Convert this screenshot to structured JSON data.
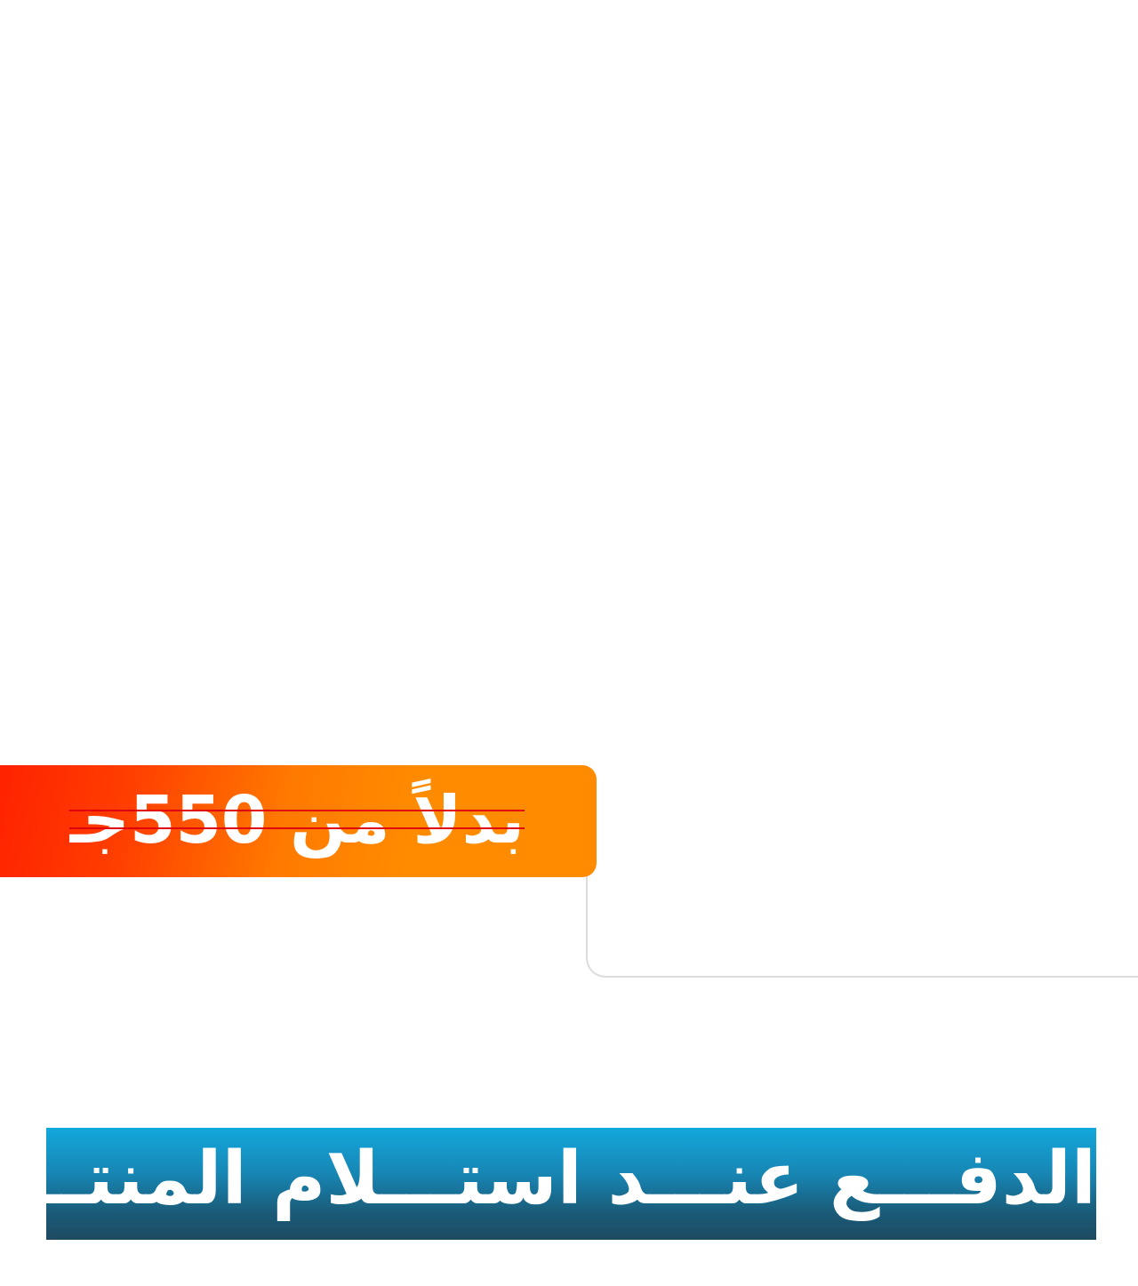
{
  "price_banner": {
    "text": "بدلاً من 550جـ",
    "strike_color": "#e0000e",
    "gradient_start": "#ff2200",
    "gradient_end": "#ff8c00"
  },
  "cod_banner": {
    "text": "الدفـــع عنـــد استـــلام المنتـــج",
    "gradient_top": "#12a8dc",
    "gradient_bottom": "#1d4a60"
  }
}
